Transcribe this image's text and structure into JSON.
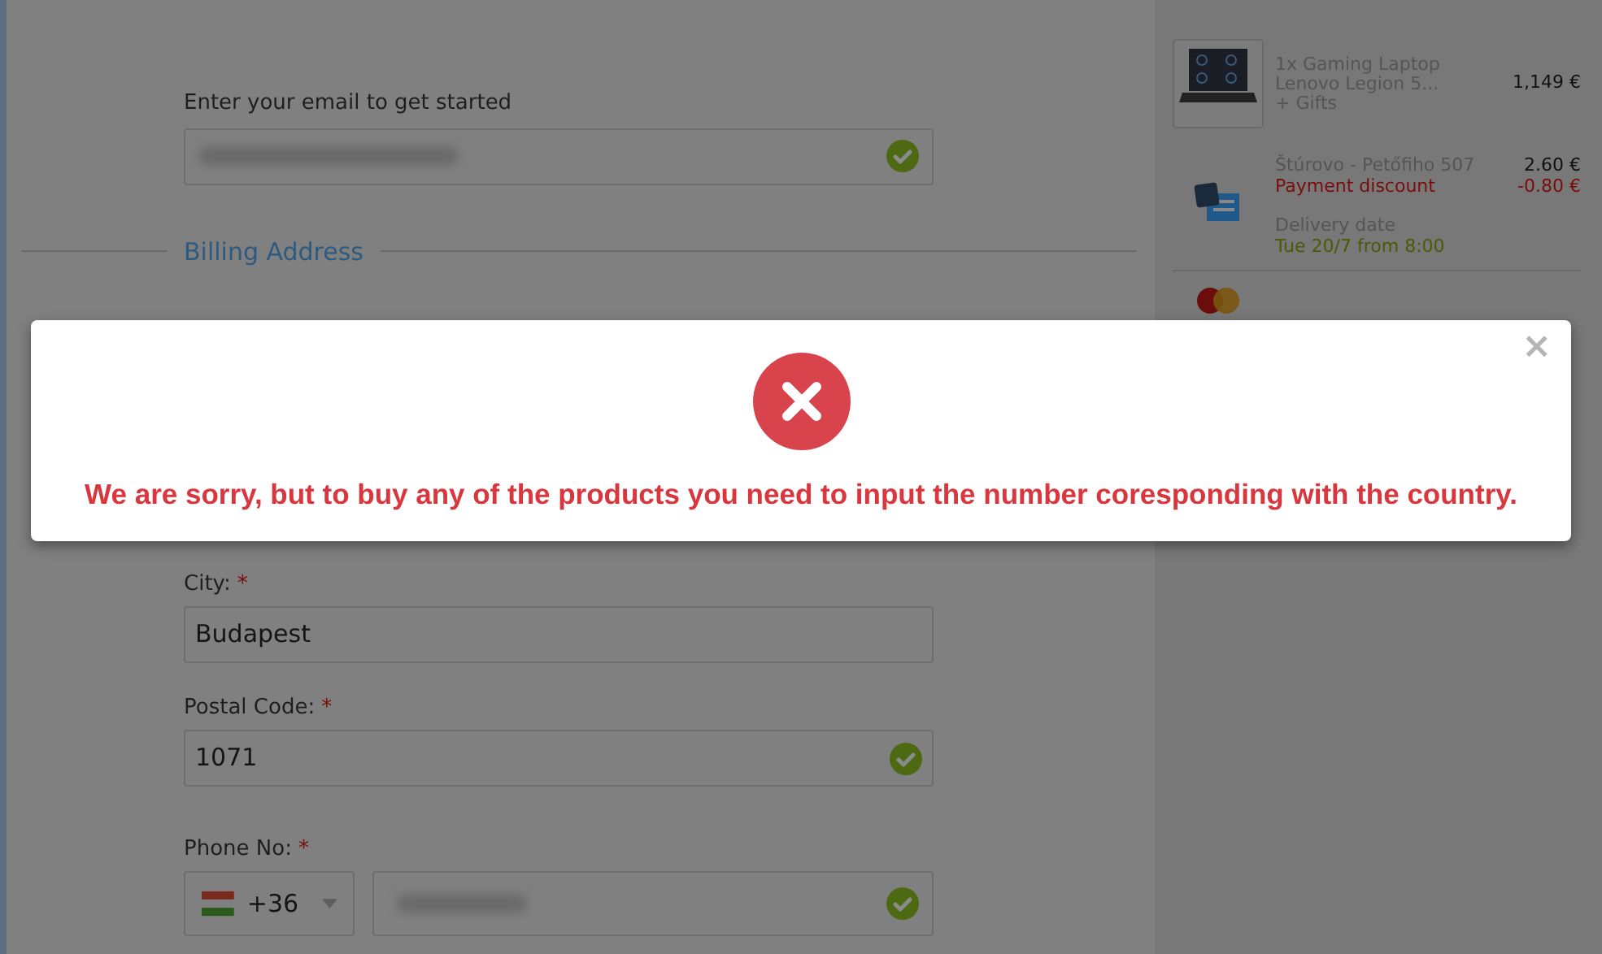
{
  "form": {
    "required_mark": "*",
    "email_label": "Enter your email to get started",
    "email_valid": true,
    "section_title": "Billing Address",
    "fields": [
      {
        "label": "City:",
        "required": true,
        "value": "Budapest",
        "valid": false
      },
      {
        "label": "Postal Code:",
        "required": true,
        "value": "1071",
        "valid": true
      }
    ],
    "phone": {
      "label": "Phone No:",
      "required": true,
      "country_code": "+36",
      "valid": true
    }
  },
  "summary": {
    "product": {
      "lines": [
        "1x Gaming Laptop",
        "Lenovo Legion 5...",
        "+ Gifts"
      ],
      "price": "1,149 €"
    },
    "delivery": {
      "place": "Štúrovo - Petőfiho 507",
      "price": "2.60 €",
      "discount_label": "Payment discount",
      "discount": "-0.80 €",
      "date_label": "Delivery date",
      "date": "Tue 20/7 from 8:00"
    }
  },
  "modal": {
    "kind": "error",
    "message": "We are sorry, but to buy any of the products you need to input the number coresponding with the country.",
    "close": "×"
  }
}
